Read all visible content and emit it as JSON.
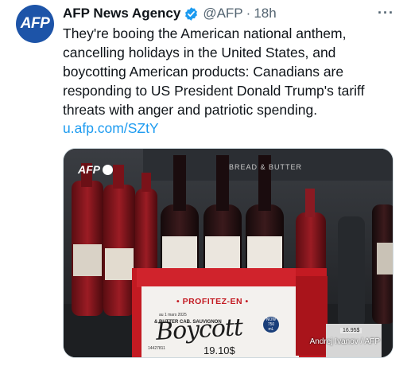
{
  "author": {
    "avatar_text": "AFP",
    "name": "AFP News Agency",
    "handle": "@AFP",
    "separator": "·",
    "time": "18h"
  },
  "more_label": "···",
  "tweet_lines": [
    "They're booing the American national anthem,",
    "cancelling holidays in the United States, and",
    "boycotting American products: Canadians are",
    "responding to US President Donald Trump's tariff",
    "threats with anger and patriotic spending."
  ],
  "link": "u.afp.com/SZtY",
  "media": {
    "watermark": "AFP",
    "credit": "Andrej Ivanov / AFP",
    "sign_title": "• PROFITEZ-EN •",
    "sign_date": "au 1 mars 2025",
    "sign_product": "& BUTTER CAB. SAUVIGNON",
    "sign_handwritten": "Boycott",
    "sign_price": "19.10$",
    "sign_badge_top": "NOW",
    "sign_badge_num": "750",
    "sign_badge_unit": "mL",
    "sign_code": "14427811",
    "right_price": "16.95$",
    "brand_text": "BREAD & BUTTER"
  },
  "colors": {
    "brand": "#1d54a8",
    "link": "#1d9bf0",
    "verified": "#1d9bf0",
    "sign_red": "#c31a22"
  }
}
